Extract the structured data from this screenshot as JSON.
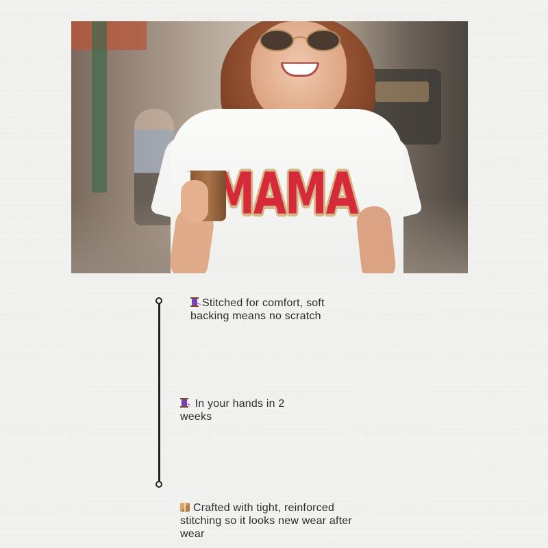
{
  "photo": {
    "shirt_text": "MAMA",
    "description_colors": {
      "shirt": "#fbfbfa",
      "lettering": "#d42a39",
      "lettering_border": "#d6b788"
    }
  },
  "timeline": {
    "line_color": "#222222",
    "features": [
      {
        "icon": "thread-spool-icon",
        "text": "Stitched for comfort, soft backing means no scratch"
      },
      {
        "icon": "thread-spool-icon",
        "text": "In your hands in 2 weeks"
      },
      {
        "icon": "package-box-icon",
        "text": "Crafted with tight, reinforced stitching so it looks new wear after wear"
      }
    ]
  }
}
